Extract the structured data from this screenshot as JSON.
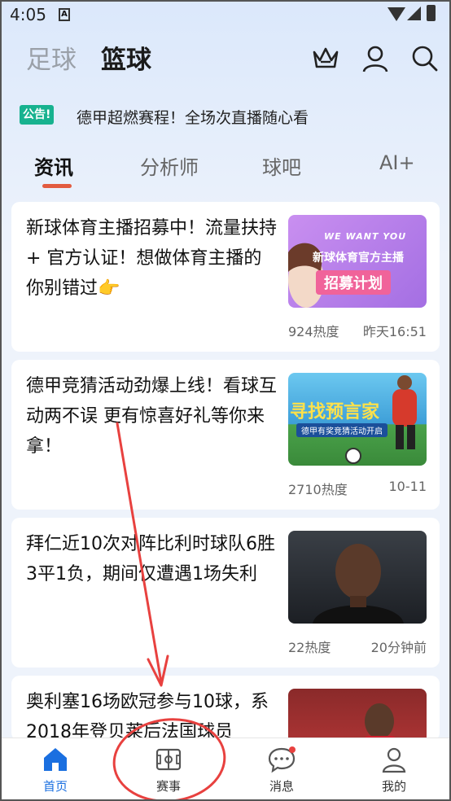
{
  "status_bar": {
    "time": "4:05",
    "a_label": "A"
  },
  "header": {
    "sport_tabs": [
      {
        "label": "足球"
      },
      {
        "label": "篮球"
      }
    ],
    "icons": [
      "crown-icon",
      "user-icon",
      "search-icon"
    ]
  },
  "notice": {
    "badge": "公告!",
    "text": "德甲超燃赛程！全场次直播随心看"
  },
  "tabs": [
    {
      "label": "资讯"
    },
    {
      "label": "分析师"
    },
    {
      "label": "球吧"
    },
    {
      "label": "AI+"
    }
  ],
  "articles": [
    {
      "title": "新球体育主播招募中！流量扶持 + 官方认证！想做体育主播的你别错过👉",
      "heat": "924热度",
      "time": "昨天16:51",
      "thumb": {
        "line1": "WE WANT YOU",
        "line2": "新球体育官方主播",
        "line3": "招募计划"
      }
    },
    {
      "title": "德甲竞猜活动劲爆上线！看球互动两不误 更有惊喜好礼等你来拿！",
      "heat": "2710热度",
      "time": "10-11",
      "thumb": {
        "line1": "寻找预言家",
        "line2": "德甲有奖竞猜活动开启"
      }
    },
    {
      "title": "拜仁近10次对阵比利时球队6胜3平1负，期间仅遭遇1场失利",
      "heat": "22热度",
      "time": "20分钟前"
    },
    {
      "title": "奥利塞16场欧冠参与10球，系2018年登贝莱后法国球员"
    }
  ],
  "nav": [
    {
      "label": "首页"
    },
    {
      "label": "赛事"
    },
    {
      "label": "消息"
    },
    {
      "label": "我的"
    }
  ],
  "colors": {
    "accent_blue": "#1a6fe0",
    "tab_underline": "#e25b3f",
    "notice_badge": "#17b28f",
    "annotation_red": "#e8413f"
  }
}
